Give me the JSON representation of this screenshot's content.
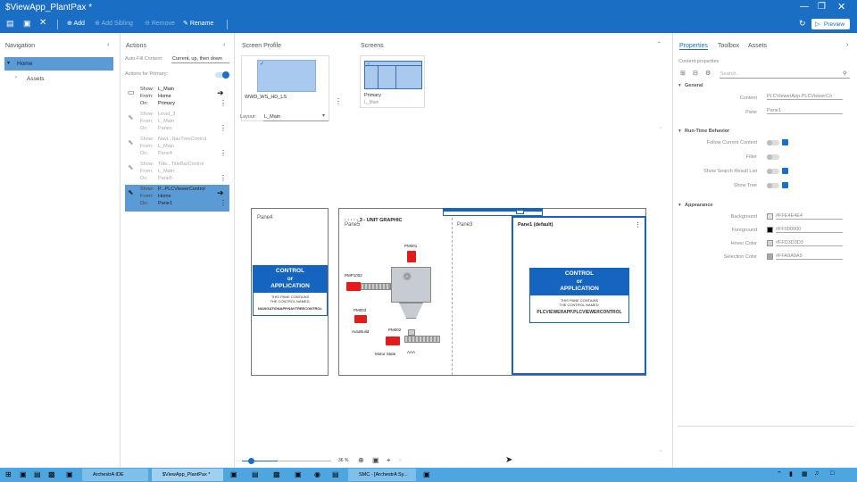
{
  "window": {
    "title": "$ViewApp_PlantPax *",
    "preview_label": "Preview"
  },
  "toolbar": {
    "add": "Add",
    "add_sibling": "Add Sibling",
    "remove": "Remove",
    "rename": "Rename"
  },
  "navigation": {
    "header": "Navigation",
    "items": [
      "Home",
      "Assets"
    ]
  },
  "actions": {
    "header": "Actions",
    "autofill_label": "Auto-Fill Content:",
    "autofill_value": "Current, up, then down",
    "actions_for": "Actions for Primary:",
    "row_labels": {
      "show": "Show:",
      "from": "From:",
      "on": "On:"
    },
    "list": [
      {
        "show": "L_Main",
        "from": "Home",
        "on": "Primary"
      },
      {
        "show": "Level_3",
        "from": "L_Main",
        "on": "Panes"
      },
      {
        "show": "Navi...NavTreeControl",
        "from": "L_Main",
        "on": "Pane4"
      },
      {
        "show": "Title...TitleBarControl",
        "from": "L_Main",
        "on": "Pane5"
      },
      {
        "show": "P...PLCViewerControl",
        "from": "Home",
        "on": "Pane1"
      }
    ]
  },
  "screen_profile": {
    "header": "Screen Profile",
    "thumb_label": "WWD_WS_HD_LS",
    "layout_label": "Layout:",
    "layout_value": "L_Main"
  },
  "screens": {
    "header": "Screens",
    "thumb_label": "Primary",
    "thumb_sub": "L_Main"
  },
  "canvas": {
    "pane4": "Pane4",
    "pane5": "Pane5",
    "unit_graphic": "· · · · - 3 - UNIT GRAPHIC",
    "pane3": "Pane3",
    "pane1": "Pane1 (default)",
    "control_box_left": {
      "line1": "CONTROL",
      "line2": "or",
      "line3": "APPLICATION",
      "small1": "THIS PANE CONTAINS",
      "small2": "THE CONTROL NAMED:",
      "name": "NAVIGATIONAPP.NAVTREECONTROL"
    },
    "control_box_right": {
      "line1": "CONTROL",
      "line2": "or",
      "line3": "APPLICATION",
      "small1": "THIS PANE CONTAINS",
      "small2": "THE CONTROL NAMED:",
      "name": "PLCVIEWERAPP.PLCVIEWERCONTROL"
    },
    "graphic_labels": {
      "pm001": "PM001",
      "pmp1002": "PMP1002",
      "pm003": "PM003",
      "autobuild": "AutoBuild",
      "pm002": "PM002",
      "motor_state": "Motor State",
      "aaa": "AAA"
    },
    "zoom": "36 %"
  },
  "properties": {
    "tabs": [
      "Properties",
      "Toolbox",
      "Assets"
    ],
    "content_properties": "Content properties",
    "search_placeholder": "Search...",
    "general": {
      "header": "General",
      "content_label": "Content",
      "content_value": "PLCViewerApp.PLCViewerCo",
      "pane_label": "Pane",
      "pane_value": "Pane1"
    },
    "runtime": {
      "header": "Run-Time Behavior",
      "follow": "Follow Current Context",
      "filter": "Filter",
      "show_search": "Show Search Result List",
      "show_tree": "Show Tree"
    },
    "appearance": {
      "header": "Appearance",
      "background_label": "Background",
      "background_value": "#FFE4E4E4",
      "foreground_label": "Foreground",
      "foreground_value": "#FF000000",
      "hover_label": "Hover Color",
      "hover_value": "#FFD3D3D3",
      "selection_label": "Selection Color",
      "selection_value": "#FFA9A9A9"
    }
  },
  "taskbar": {
    "items": [
      "ArchestrA IDE",
      "$ViewApp_PlantPax *",
      "SMC - [ArchestrA Sy..."
    ]
  },
  "colors": {
    "accent": "#1a6fc4",
    "selection": "#5b9bd5",
    "pane_blue": "#1565c0",
    "motor_red": "#e21b1b",
    "taskbar": "#4da6e0"
  }
}
